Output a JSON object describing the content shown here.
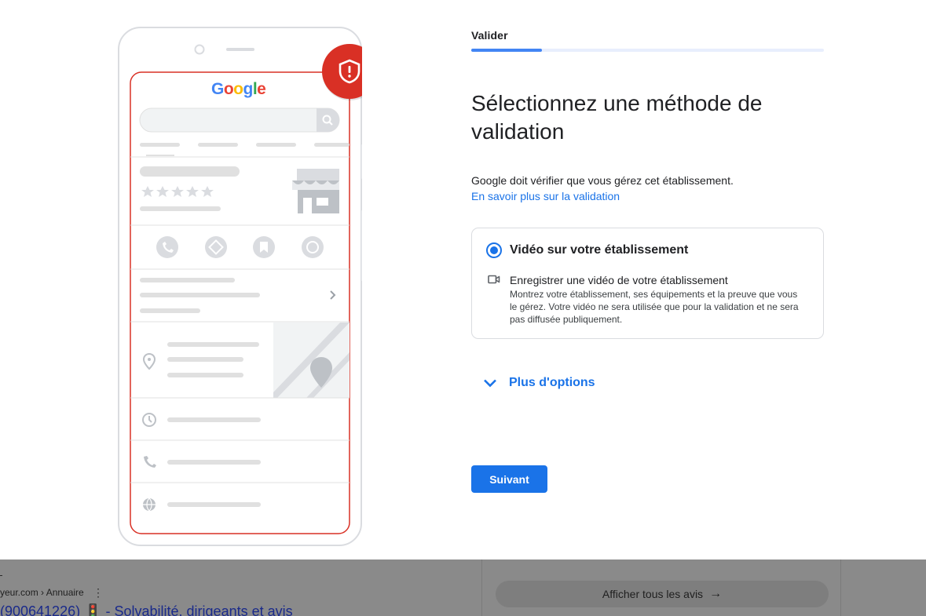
{
  "colors": {
    "accent": "#1a73e8",
    "progress": "#4285f4",
    "alert_badge": "#d93025",
    "phone_outline": "#d93025"
  },
  "wizard": {
    "step_label": "Valider",
    "progress_fraction": 0.2,
    "heading": "Sélectionnez une méthode de validation",
    "intro": "Google doit vérifier que vous gérez cet établissement.",
    "learn_more_link": "En savoir plus sur la validation"
  },
  "option": {
    "selected": true,
    "title": "Vidéo sur votre établissement",
    "icon": "video-camera-icon",
    "sub_title": "Enregistrer une vidéo de votre établissement",
    "description": "Montrez votre établissement, ses équipements et la preuve que vous le gérez. Votre vidéo ne sera utilisée que pour la validation et ne sera pas diffusée publiquement."
  },
  "more_options_label": "Plus d'options",
  "next_label": "Suivant",
  "illustration": {
    "logo_text": "Google",
    "badge_icon": "shield-alert-icon"
  },
  "background": {
    "breadcrumb": "yeur.com › Annuaire",
    "result_title": "(900641226) 🚦 - Solvabilité, dirigeants et avis",
    "reviews_button": "Afficher tous les avis"
  }
}
